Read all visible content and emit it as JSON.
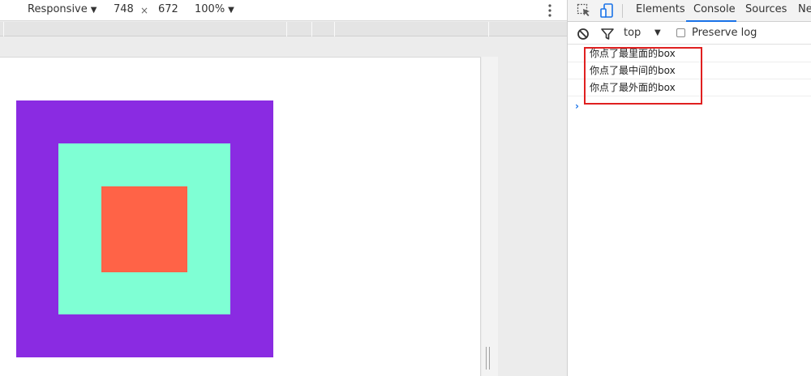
{
  "device_toolbar": {
    "device": "Responsive",
    "width": "748",
    "times": "×",
    "height": "672",
    "zoom": "100%",
    "caret": "▼"
  },
  "devtools": {
    "tabs": [
      "Elements",
      "Console",
      "Sources",
      "Ne"
    ],
    "active_tab": "Console",
    "console_toolbar": {
      "context": "top",
      "caret": "▼",
      "preserve_log_label": "Preserve log",
      "preserve_log_checked": false
    },
    "console_messages": [
      "你点了最里面的box",
      "你点了最中间的box",
      "你点了最外面的box"
    ],
    "prompt": "›"
  },
  "page": {
    "box_colors": {
      "outer": "#8a2be2",
      "middle": "#7fffd4",
      "inner": "#ff6347"
    }
  },
  "colors": {
    "accent": "#1a73e8",
    "highlight": "#e02020"
  }
}
